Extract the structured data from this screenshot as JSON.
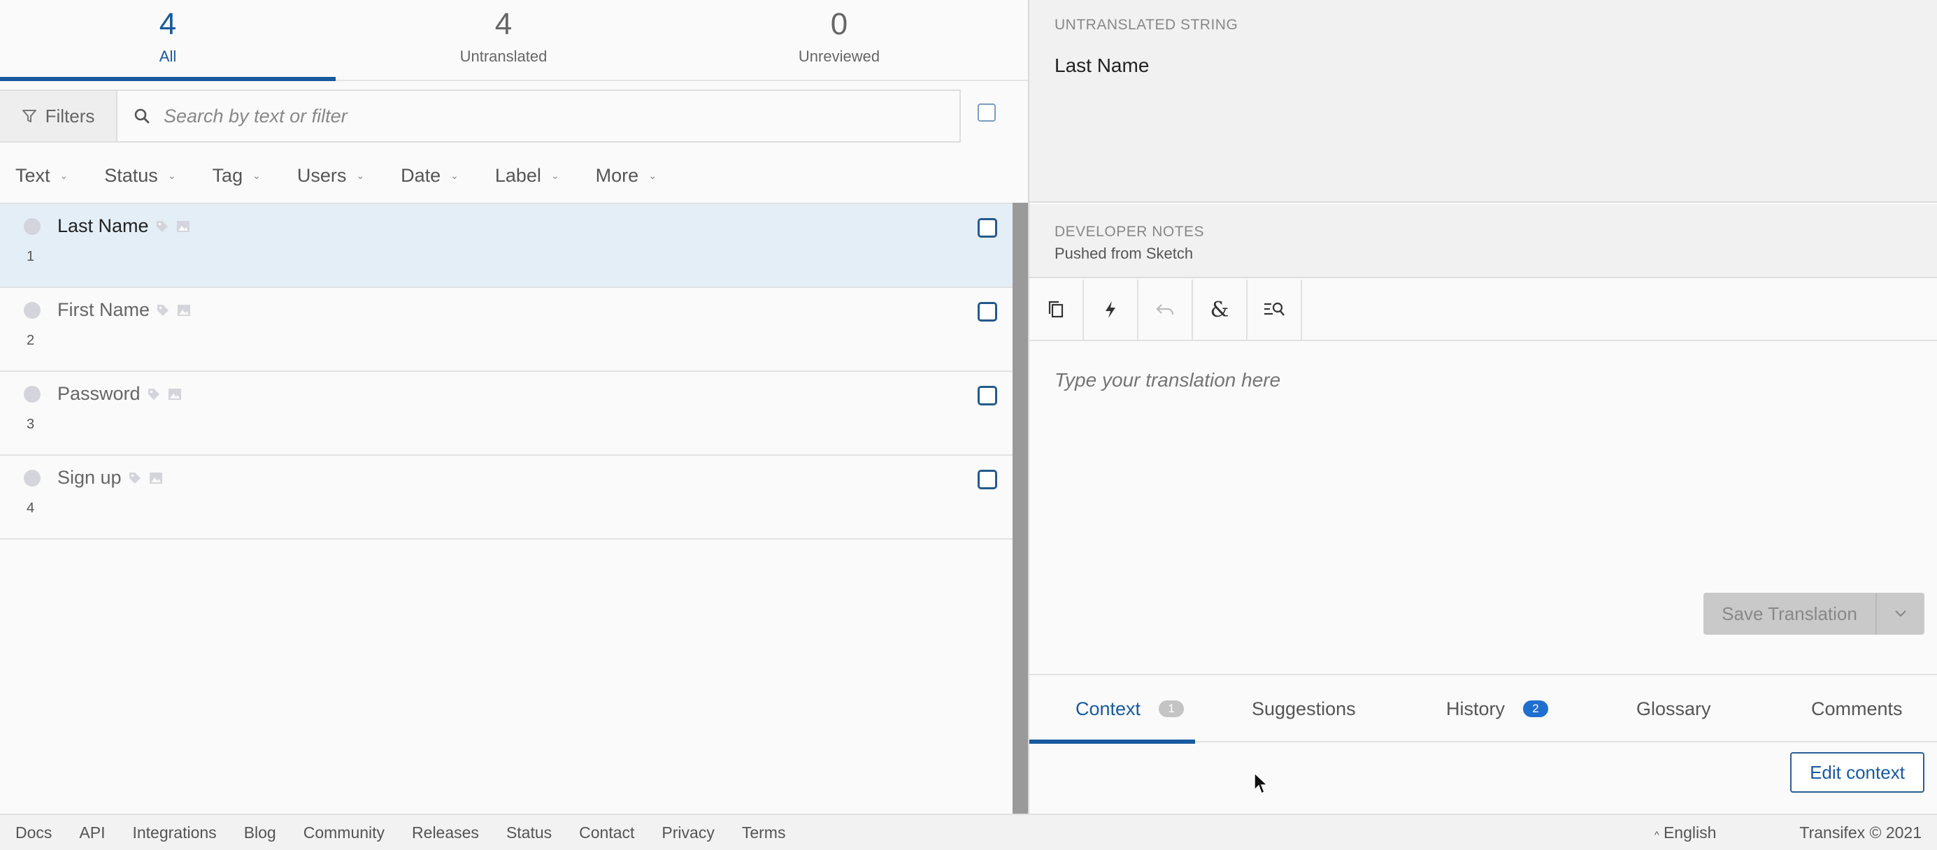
{
  "summary_tabs": [
    {
      "count": "4",
      "label": "All",
      "active": true
    },
    {
      "count": "4",
      "label": "Untranslated",
      "active": false
    },
    {
      "count": "0",
      "label": "Unreviewed",
      "active": false
    }
  ],
  "filters": {
    "button_label": "Filters",
    "search_placeholder": "Search by text or filter",
    "facets": [
      "Text",
      "Status",
      "Tag",
      "Users",
      "Date",
      "Label",
      "More"
    ]
  },
  "strings": [
    {
      "text": "Last Name",
      "index": "1",
      "selected": true
    },
    {
      "text": "First Name",
      "index": "2",
      "selected": false
    },
    {
      "text": "Password",
      "index": "3",
      "selected": false
    },
    {
      "text": "Sign up",
      "index": "4",
      "selected": false
    }
  ],
  "source": {
    "caption": "UNTRANSLATED STRING",
    "text": "Last Name"
  },
  "developer_notes": {
    "caption": "DEVELOPER NOTES",
    "text": "Pushed from Sketch"
  },
  "toolbar_icons": [
    "copy-source-icon",
    "auto-translate-icon",
    "undo-icon",
    "special-characters-icon",
    "search-concordance-icon"
  ],
  "editor": {
    "placeholder": "Type your translation here"
  },
  "save": {
    "label": "Save Translation"
  },
  "bottom_tabs": {
    "context": {
      "label": "Context",
      "badge": "1"
    },
    "suggestions": {
      "label": "Suggestions"
    },
    "history": {
      "label": "History",
      "badge": "2"
    },
    "glossary": {
      "label": "Glossary"
    },
    "comments": {
      "label": "Comments"
    }
  },
  "edit_context_label": "Edit context",
  "footer": {
    "links": [
      "Docs",
      "API",
      "Integrations",
      "Blog",
      "Community",
      "Releases",
      "Status",
      "Contact",
      "Privacy",
      "Terms"
    ],
    "language": "English",
    "copyright": "Transifex © 2021"
  },
  "colors": {
    "accent": "#175a9e",
    "selected_row": "#e4eef7",
    "badge_blue": "#1e6fd0"
  }
}
